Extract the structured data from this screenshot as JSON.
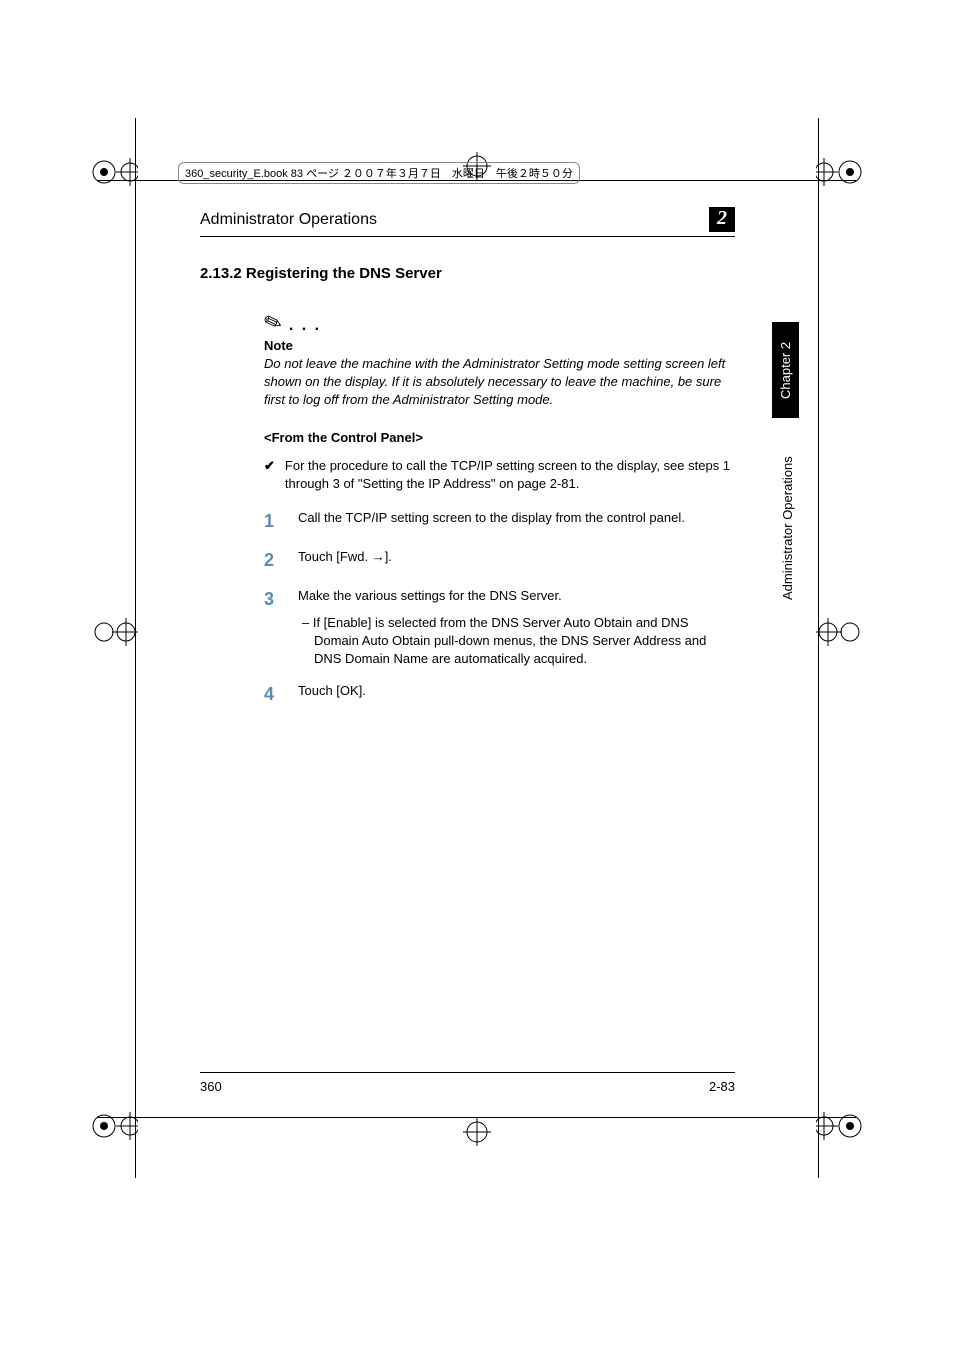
{
  "book_info": "360_security_E.book  83 ページ  ２００７年３月７日　水曜日　午後２時５０分",
  "header": {
    "title": "Administrator Operations",
    "chapter_num": "2"
  },
  "section": {
    "number": "2.13.2",
    "title": "Registering the DNS Server"
  },
  "note": {
    "label": "Note",
    "text": "Do not leave the machine with the Administrator Setting mode setting screen left shown on the display. If it is absolutely necessary to leave the machine, be sure first to log off from the Administrator Setting mode."
  },
  "sub_header": "<From the Control Panel>",
  "check_item": "For the procedure to call the TCP/IP setting screen to the display, see steps 1 through 3 of \"Setting the IP Address\" on page 2-81.",
  "steps": [
    {
      "num": "1",
      "text": "Call the TCP/IP setting screen to the display from the control panel."
    },
    {
      "num": "2",
      "text": "Touch [Fwd. →]."
    },
    {
      "num": "3",
      "text": "Make the various settings for the DNS Server.",
      "sub": "–   If [Enable] is selected from the DNS Server Auto Obtain and DNS Domain Auto Obtain pull-down menus, the DNS Server Address and DNS Domain Name are automatically acquired."
    },
    {
      "num": "4",
      "text": "Touch [OK]."
    }
  ],
  "side_tabs": {
    "chapter": "Chapter 2",
    "section": "Administrator Operations"
  },
  "footer": {
    "left": "360",
    "right": "2-83"
  }
}
